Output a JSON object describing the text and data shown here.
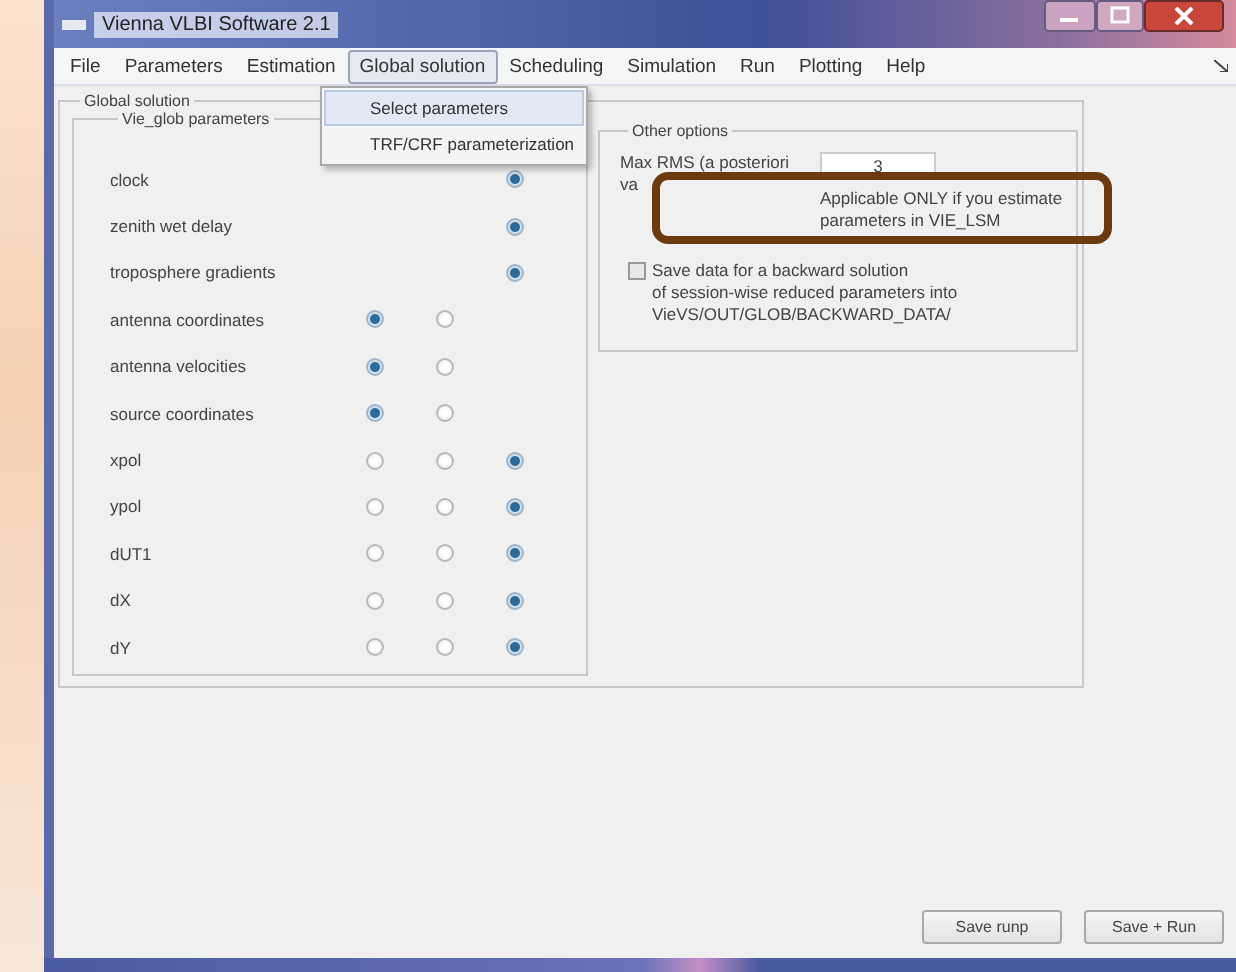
{
  "window": {
    "title": "Vienna VLBI Software 2.1"
  },
  "menu": [
    {
      "label": "File",
      "selected": false
    },
    {
      "label": "Parameters",
      "selected": false
    },
    {
      "label": "Estimation",
      "selected": false
    },
    {
      "label": "Global solution",
      "selected": true
    },
    {
      "label": "Scheduling",
      "selected": false
    },
    {
      "label": "Simulation",
      "selected": false
    },
    {
      "label": "Run",
      "selected": false
    },
    {
      "label": "Plotting",
      "selected": false
    },
    {
      "label": "Help",
      "selected": false
    }
  ],
  "dropdown": [
    {
      "label": "Select parameters",
      "selected": true
    },
    {
      "label": "TRF/CRF parameterization",
      "selected": false
    }
  ],
  "global_solution": {
    "title": "Global solution",
    "vie_glob": {
      "title": "Vie_glob parameters",
      "rows": [
        {
          "label": "clock",
          "options": [
            {
              "kind": "none"
            },
            {
              "kind": "none"
            },
            {
              "kind": "radio",
              "selected": true
            }
          ]
        },
        {
          "label": "zenith wet delay",
          "options": [
            {
              "kind": "none"
            },
            {
              "kind": "none"
            },
            {
              "kind": "radio",
              "selected": true
            }
          ]
        },
        {
          "label": "troposphere gradients",
          "options": [
            {
              "kind": "none"
            },
            {
              "kind": "none"
            },
            {
              "kind": "radio",
              "selected": true
            }
          ]
        },
        {
          "label": "antenna coordinates",
          "options": [
            {
              "kind": "radio",
              "selected": true
            },
            {
              "kind": "radio",
              "selected": false
            },
            {
              "kind": "none"
            }
          ]
        },
        {
          "label": "antenna velocities",
          "options": [
            {
              "kind": "radio",
              "selected": true
            },
            {
              "kind": "radio",
              "selected": false
            },
            {
              "kind": "none"
            }
          ]
        },
        {
          "label": "source coordinates",
          "options": [
            {
              "kind": "radio",
              "selected": true
            },
            {
              "kind": "radio",
              "selected": false
            },
            {
              "kind": "none"
            }
          ]
        },
        {
          "label": "xpol",
          "options": [
            {
              "kind": "radio",
              "selected": false
            },
            {
              "kind": "radio",
              "selected": false
            },
            {
              "kind": "radio",
              "selected": true
            }
          ]
        },
        {
          "label": "ypol",
          "options": [
            {
              "kind": "radio",
              "selected": false
            },
            {
              "kind": "radio",
              "selected": false
            },
            {
              "kind": "radio",
              "selected": true
            }
          ]
        },
        {
          "label": "dUT1",
          "options": [
            {
              "kind": "radio",
              "selected": false
            },
            {
              "kind": "radio",
              "selected": false
            },
            {
              "kind": "radio",
              "selected": true
            }
          ]
        },
        {
          "label": "dX",
          "options": [
            {
              "kind": "radio",
              "selected": false
            },
            {
              "kind": "radio",
              "selected": false
            },
            {
              "kind": "radio",
              "selected": true
            }
          ]
        },
        {
          "label": "dY",
          "options": [
            {
              "kind": "radio",
              "selected": false
            },
            {
              "kind": "radio",
              "selected": false
            },
            {
              "kind": "radio",
              "selected": true
            }
          ]
        }
      ]
    },
    "other_options": {
      "title": "Other options",
      "max_rms_label": [
        "Max RMS (a posteriori",
        "va"
      ],
      "max_rms_value": "3",
      "note": [
        "Applicable ONLY if you estimate",
        "parameters in VIE_LSM"
      ],
      "backward": {
        "checked": false,
        "label": [
          "Save data for a backward solution",
          "of session-wise reduced parameters into",
          "VieVS/OUT/GLOB/BACKWARD_DATA/"
        ]
      }
    }
  },
  "overlay": {
    "kind": "highlight-frame"
  },
  "buttons": [
    "Save runp",
    "Save + Run"
  ]
}
